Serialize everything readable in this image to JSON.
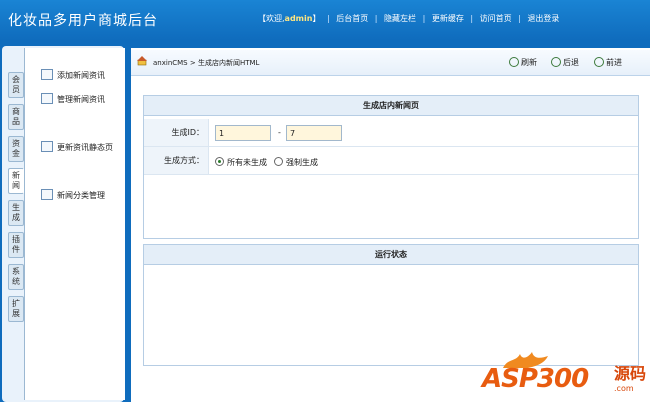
{
  "header": {
    "title": "化妆品多用户商城后台",
    "welcome": "【欢迎,",
    "username": "admin",
    "welcome_end": "】",
    "nav": [
      "后台首页",
      "隐藏左栏",
      "更新缓存",
      "访问首页",
      "退出登录"
    ]
  },
  "sidebar": {
    "tabs": [
      "会员",
      "商品",
      "资金",
      "新闻",
      "生成",
      "插件",
      "系统",
      "扩展"
    ],
    "active_tab": "新闻",
    "menu": [
      {
        "label": "添加新闻资讯",
        "icon": "folder-icon"
      },
      {
        "label": "管理新闻资讯",
        "icon": "document-icon"
      },
      {
        "label": "更新资讯静态页",
        "icon": "document-icon"
      },
      {
        "label": "新闻分类管理",
        "icon": "list-icon"
      }
    ]
  },
  "breadcrumb": {
    "root": "anxinCMS",
    "separator": ">",
    "current": "生成店内新闻HTML"
  },
  "toolbar": {
    "refresh": "刷新",
    "back": "后退",
    "forward": "前进"
  },
  "form": {
    "title": "生成店内新闻页",
    "id_label": "生成ID：",
    "id_from": "1",
    "id_dash": "-",
    "id_to": "7",
    "mode_label": "生成方式：",
    "mode_options": [
      "所有未生成",
      "强制生成"
    ],
    "mode_selected": "所有未生成"
  },
  "status": {
    "title": "运行状态"
  },
  "watermark": {
    "brand": "ASP300",
    "cn": "源码",
    "url": ".com"
  },
  "colors": {
    "header_blue": "#1a84d4",
    "accent_orange": "#e85c10"
  }
}
